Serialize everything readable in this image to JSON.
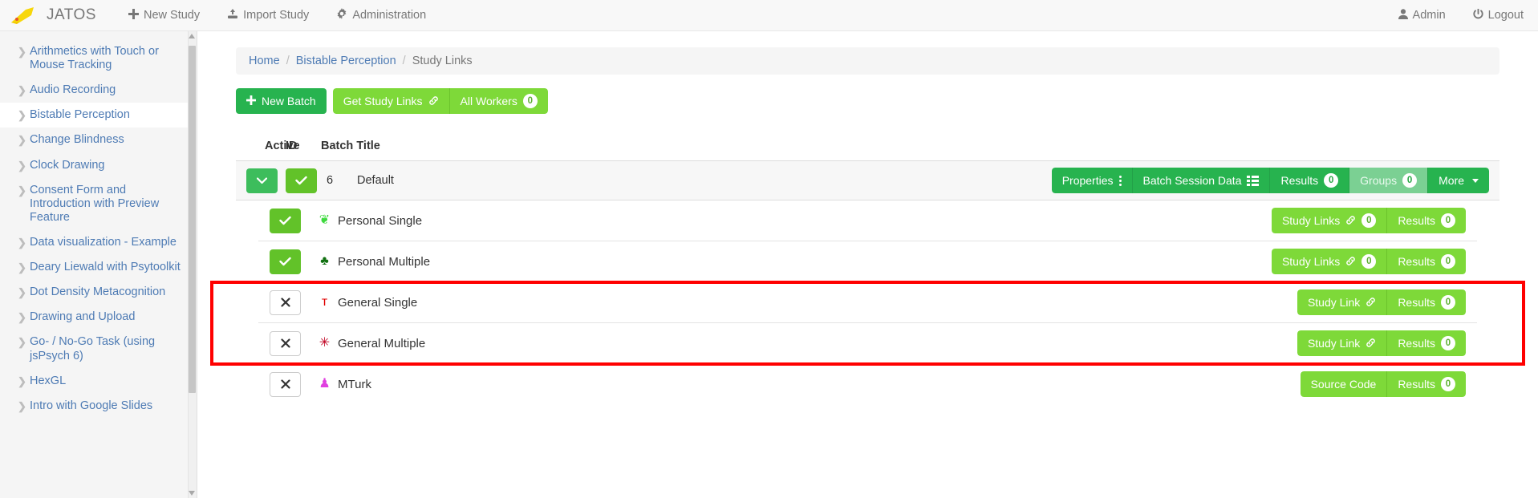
{
  "navbar": {
    "brand": "JATOS",
    "logo_icon": "jatos-rocket-logo",
    "items": [
      {
        "label": "New Study",
        "icon": "plus-icon"
      },
      {
        "label": "Import Study",
        "icon": "import-icon"
      },
      {
        "label": "Administration",
        "icon": "gear-icon"
      }
    ],
    "right_items": [
      {
        "label": "Admin",
        "icon": "user-icon"
      },
      {
        "label": "Logout",
        "icon": "power-icon"
      }
    ]
  },
  "sidebar": {
    "items": [
      {
        "label": "Arithmetics with Touch or Mouse Tracking",
        "active": false
      },
      {
        "label": "Audio Recording",
        "active": false
      },
      {
        "label": "Bistable Perception",
        "active": true
      },
      {
        "label": "Change Blindness",
        "active": false
      },
      {
        "label": "Clock Drawing",
        "active": false
      },
      {
        "label": "Consent Form and Introduction with Preview Feature",
        "active": false
      },
      {
        "label": "Data visualization - Example",
        "active": false
      },
      {
        "label": "Deary Liewald with Psytoolkit",
        "active": false
      },
      {
        "label": "Dot Density Metacognition",
        "active": false
      },
      {
        "label": "Drawing and Upload",
        "active": false
      },
      {
        "label": "Go- / No-Go Task (using jsPsych 6)",
        "active": false
      },
      {
        "label": "HexGL",
        "active": false
      },
      {
        "label": "Intro with Google Slides",
        "active": false
      }
    ]
  },
  "breadcrumb": {
    "home": "Home",
    "study": "Bistable Perception",
    "current": "Study Links",
    "separator": "/"
  },
  "toolbar": {
    "new_batch": "New Batch",
    "new_batch_icon": "plus-icon",
    "get_study_links": "Get Study Links",
    "get_study_links_icon": "link-icon",
    "all_workers": "All Workers",
    "all_workers_count": "0"
  },
  "table": {
    "headers": {
      "active": "Active",
      "id": "ID",
      "title": "Batch Title"
    },
    "batch": {
      "id": "6",
      "title": "Default",
      "toggle_icon": "chevron-down-icon",
      "active_icon": "check-icon",
      "actions": [
        {
          "label": "Properties",
          "icon": "vertical-dots-icon",
          "muted": false,
          "badge": null
        },
        {
          "label": "Batch Session Data",
          "icon": "grid-icon",
          "muted": false,
          "badge": null
        },
        {
          "label": "Results",
          "icon": null,
          "muted": false,
          "badge": "0"
        },
        {
          "label": "Groups",
          "icon": null,
          "muted": true,
          "badge": "0"
        },
        {
          "label": "More",
          "icon": "caret-down-icon",
          "muted": false,
          "badge": null
        }
      ]
    },
    "worker_rows": [
      {
        "name": "Personal Single",
        "icon": "leaf-icon",
        "icon_glyph": "❦",
        "icon_color": "#3ed93e",
        "enabled": true,
        "toggle_icon": "check-icon",
        "actions": [
          {
            "label": "Study Links",
            "icon": "link-icon",
            "badge": "0"
          },
          {
            "label": "Results",
            "icon": null,
            "badge": "0"
          }
        ]
      },
      {
        "name": "Personal Multiple",
        "icon": "tree-icon",
        "icon_glyph": "♣",
        "icon_color": "#107010",
        "enabled": true,
        "toggle_icon": "check-icon",
        "actions": [
          {
            "label": "Study Links",
            "icon": "link-icon",
            "badge": "0"
          },
          {
            "label": "Results",
            "icon": null,
            "badge": "0"
          }
        ]
      },
      {
        "name": "General Single",
        "icon": "cocktail-glass-icon",
        "icon_glyph": "ᴛ",
        "icon_color": "#e00000",
        "enabled": false,
        "toggle_icon": "cross-icon",
        "actions": [
          {
            "label": "Study Link",
            "icon": "link-icon",
            "badge": null
          },
          {
            "label": "Results",
            "icon": null,
            "badge": "0"
          }
        ]
      },
      {
        "name": "General Multiple",
        "icon": "asterisk-flower-icon",
        "icon_glyph": "✳",
        "icon_color": "#c00020",
        "enabled": false,
        "toggle_icon": "cross-icon",
        "actions": [
          {
            "label": "Study Link",
            "icon": "link-icon",
            "badge": null
          },
          {
            "label": "Results",
            "icon": null,
            "badge": "0"
          }
        ]
      },
      {
        "name": "MTurk",
        "icon": "mturk-worker-icon",
        "icon_glyph": "♟",
        "icon_color": "#e040e0",
        "enabled": false,
        "toggle_icon": "cross-icon",
        "actions": [
          {
            "label": "Source Code",
            "icon": null,
            "badge": null
          },
          {
            "label": "Results",
            "icon": null,
            "badge": "0"
          }
        ]
      }
    ]
  },
  "annotation": {
    "highlight_color": "#ff0000",
    "highlight_rows": [
      "General Single",
      "General Multiple"
    ]
  },
  "colors": {
    "brand_yellow": "#f5d60a",
    "green_dark": "#27b34f",
    "green_light": "#7ed939",
    "link_blue": "#4e7bb4",
    "text_gray": "#777777"
  }
}
